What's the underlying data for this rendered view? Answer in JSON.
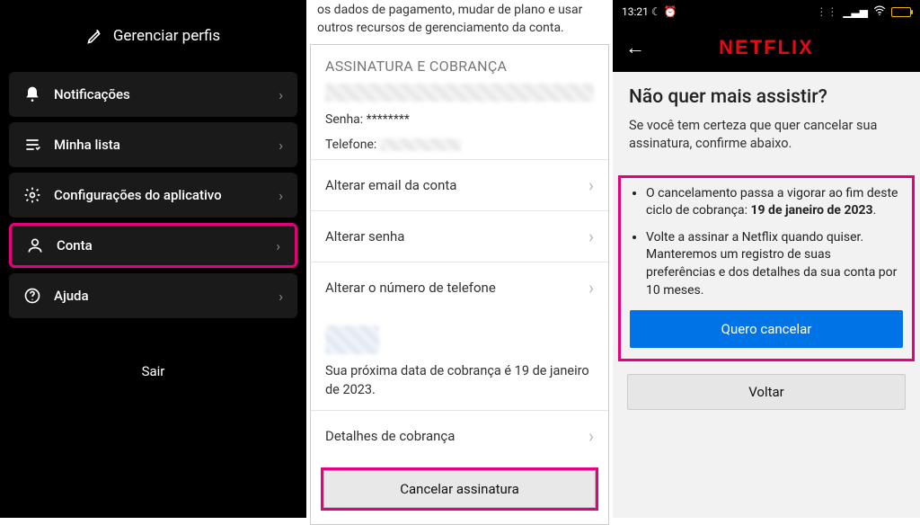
{
  "panel1": {
    "header": "Gerenciar perfis",
    "items": [
      {
        "label": "Notificações"
      },
      {
        "label": "Minha lista"
      },
      {
        "label": "Configurações do aplicativo"
      },
      {
        "label": "Conta"
      },
      {
        "label": "Ajuda"
      }
    ],
    "logout": "Sair"
  },
  "panel2": {
    "intro": "os dados de pagamento, mudar de plano e usar outros recursos de gerenciamento da conta.",
    "section_title": "ASSINATURA E COBRANÇA",
    "password_label": "Senha: ",
    "password_value": "********",
    "phone_label": "Telefone: ",
    "rows": [
      "Alterar email da conta",
      "Alterar senha",
      "Alterar o número de telefone"
    ],
    "billing_note": "Sua próxima data de cobrança é 19 de janeiro de 2023.",
    "billing_row": "Detalhes de cobrança",
    "cancel_btn": "Cancelar assinatura"
  },
  "panel3": {
    "status_time": "13:21",
    "logo": "NETFLIX",
    "title": "Não quer mais assistir?",
    "subtitle": "Se você tem certeza que quer cancelar sua assinatura, confirme abaixo.",
    "bullet1_pre": "O cancelamento passa a vigorar ao fim deste ciclo de cobrança: ",
    "bullet1_bold": "19 de janeiro de 2023",
    "bullet1_post": ".",
    "bullet2": "Volte a assinar a Netflix quando quiser. Manteremos um registro de suas preferências e dos detalhes da sua conta por 10 meses.",
    "confirm_btn": "Quero cancelar",
    "back_btn": "Voltar"
  }
}
